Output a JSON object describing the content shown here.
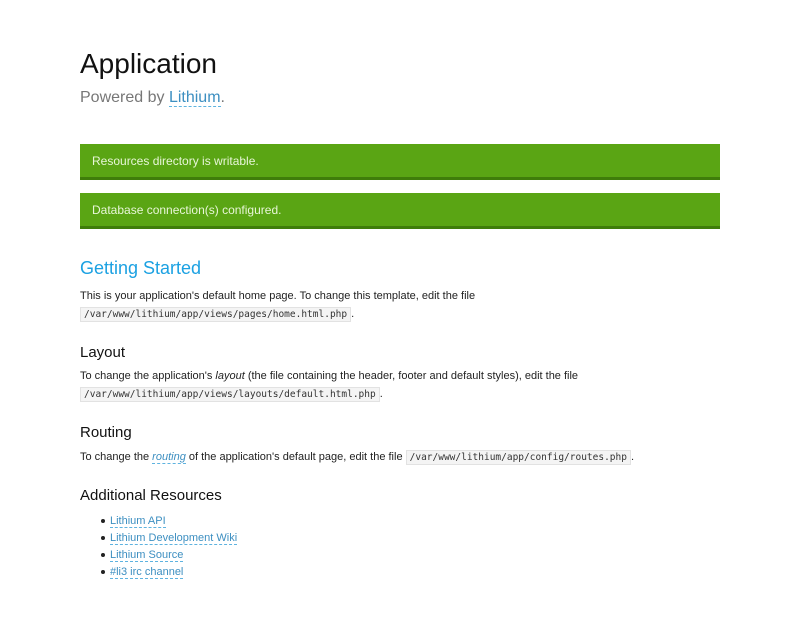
{
  "header": {
    "title": "Application",
    "powered_prefix": "Powered by ",
    "powered_brand": "Lithium",
    "powered_suffix": "."
  },
  "alerts": [
    {
      "text": "Resources directory is writable.",
      "color": "#5aa514"
    },
    {
      "text": "Database connection(s) configured.",
      "color": "#5aa514"
    }
  ],
  "getting_started": {
    "title": "Getting Started",
    "text": "This is your application's default home page. To change this template, edit the file",
    "code": "/var/www/lithium/app/views/pages/home.html.php",
    "suffix": "."
  },
  "layout": {
    "title": "Layout",
    "text_before": "To change the application's ",
    "em": "layout",
    "text_after": " (the file containing the header, footer and default styles), edit the file",
    "code": "/var/www/lithium/app/views/layouts/default.html.php",
    "suffix": "."
  },
  "routing": {
    "title": "Routing",
    "text_before": "To change the ",
    "link": "routing",
    "text_after": " of the application's default page, edit the file ",
    "code": "/var/www/lithium/app/config/routes.php",
    "suffix": "."
  },
  "resources": {
    "title": "Additional Resources",
    "items": [
      {
        "label": "Lithium API"
      },
      {
        "label": "Lithium Development Wiki"
      },
      {
        "label": "Lithium Source"
      },
      {
        "label": "#li3 irc channel"
      }
    ]
  },
  "colors": {
    "accent": "#1ba1e2",
    "link": "#3d8fc1",
    "alert_bg": "#5aa514"
  }
}
